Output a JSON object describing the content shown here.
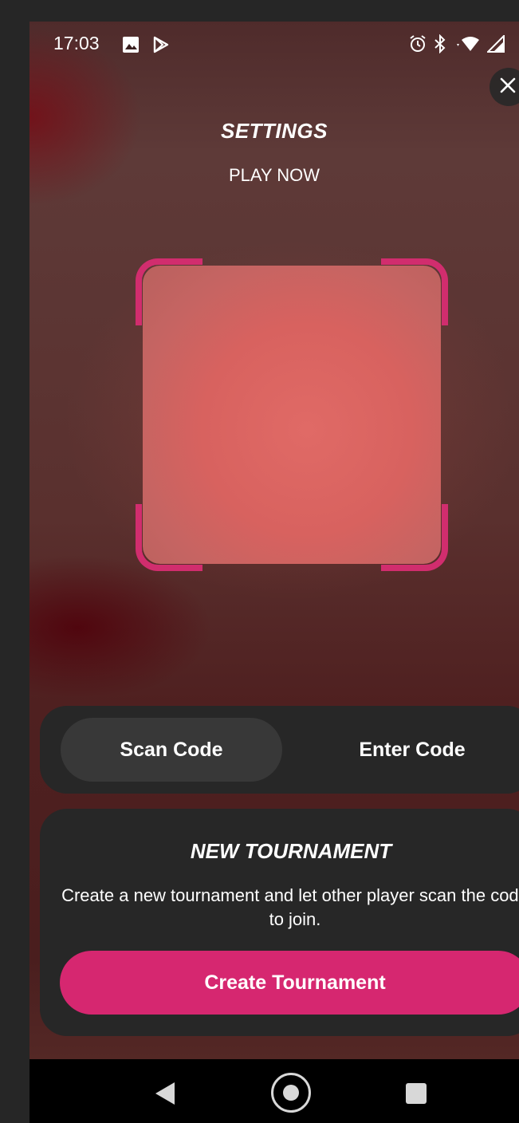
{
  "status_bar": {
    "time": "17:03",
    "left_icons": [
      "image-icon",
      "play-store-icon"
    ],
    "right_icons": [
      "alarm-icon",
      "bluetooth-icon",
      "wifi-icon",
      "signal-icon"
    ]
  },
  "header": {
    "title": "SETTINGS",
    "subtitle": "PLAY NOW",
    "close_icon": "close-icon"
  },
  "scanner": {
    "frame_color": "#d12d6e"
  },
  "tabs": [
    {
      "label": "Scan Code",
      "selected": true
    },
    {
      "label": "Enter Code",
      "selected": false
    }
  ],
  "tournament_card": {
    "title": "NEW TOURNAMENT",
    "description": "Create a new tournament and let other player scan the code to join.",
    "button_label": "Create Tournament",
    "button_color": "#d62770"
  },
  "nav_bar": {
    "icons": [
      "back-icon",
      "home-icon",
      "recents-icon"
    ]
  }
}
